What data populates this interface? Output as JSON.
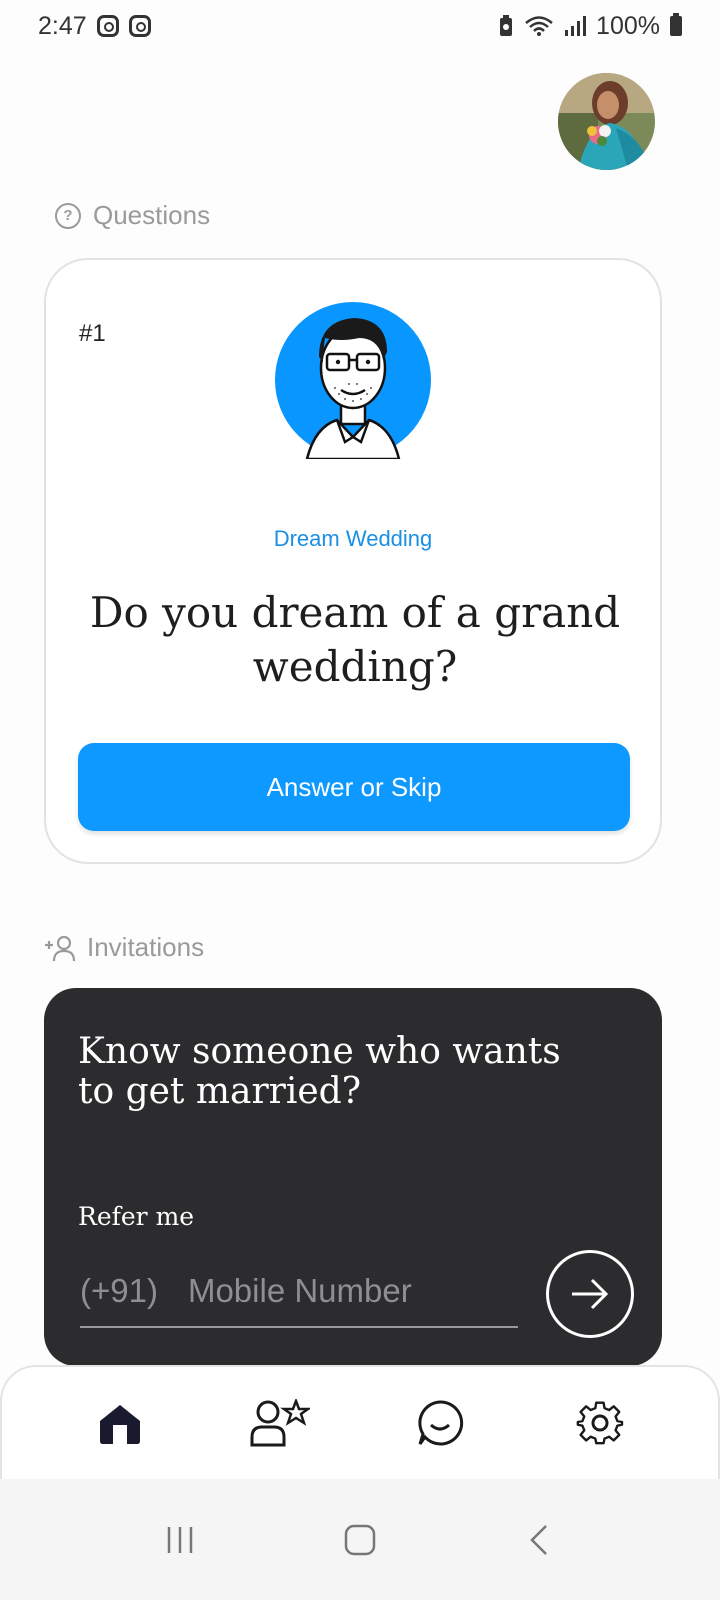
{
  "status_bar": {
    "time": "2:47",
    "battery": "100%"
  },
  "sections": {
    "questions_label": "Questions",
    "invitations_label": "Invitations"
  },
  "question_card": {
    "number": "#1",
    "category": "Dream Wedding",
    "question": "Do you dream of a grand wedding?",
    "button_label": "Answer or Skip"
  },
  "invite_card": {
    "title": "Know someone who wants to get married?",
    "refer_label": "Refer me",
    "country_code": "(+91)",
    "mobile_placeholder": "Mobile Number"
  },
  "bottom_nav": {
    "items": [
      {
        "icon": "home-icon",
        "active": true
      },
      {
        "icon": "person-star-icon",
        "active": false
      },
      {
        "icon": "chat-icon",
        "active": false
      },
      {
        "icon": "gear-icon",
        "active": false
      }
    ]
  },
  "colors": {
    "accent": "#0d99ff",
    "category": "#1a8fe6",
    "invite_card_bg": "#2c2c2e",
    "avatar_bg": "#0a96ff"
  }
}
